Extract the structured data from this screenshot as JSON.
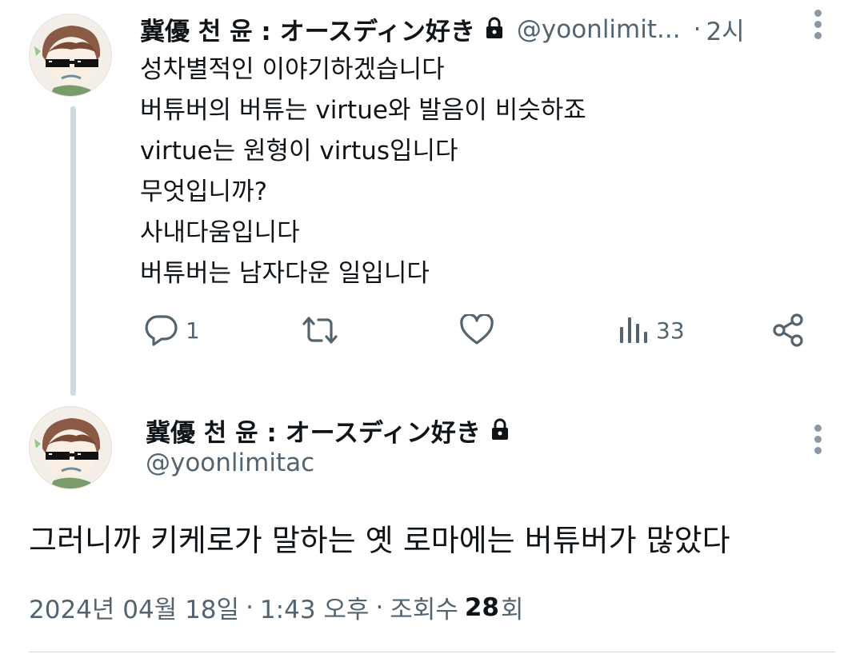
{
  "colors": {
    "text_primary": "#0f1419",
    "text_secondary": "#536471",
    "thread_line": "#cfd9de"
  },
  "post1": {
    "display_name": "冀優 천 윤 : オースディン好き",
    "handle": "@yoonlimit...",
    "separator": "·",
    "time": "2시",
    "lines": [
      "성차별적인 이야기하겠습니다",
      "버튜버의 버튜는 virtue와 발음이 비슷하죠",
      "virtue는 원형이 virtus입니다",
      "무엇입니까?",
      "사내다움입니다",
      "버튜버는 남자다운 일입니다"
    ],
    "actions": {
      "reply_count": "1",
      "repost_count": "",
      "like_count": "",
      "views_count": "33"
    },
    "icons": [
      "lock-icon",
      "more-icon",
      "reply-icon",
      "repost-icon",
      "like-icon",
      "views-icon",
      "share-icon"
    ]
  },
  "post2": {
    "display_name": "冀優 천 윤 : オースディン好き",
    "handle": "@yoonlimitac",
    "text": "그러니까 키케로가 말하는 옛 로마에는 버튜버가 많았다",
    "meta": {
      "date": "2024년 04월 18일",
      "sep1": "·",
      "time": "1:43 오후",
      "sep2": "·",
      "views_label": "조회수",
      "views_count": "28",
      "views_suffix": "회"
    }
  }
}
